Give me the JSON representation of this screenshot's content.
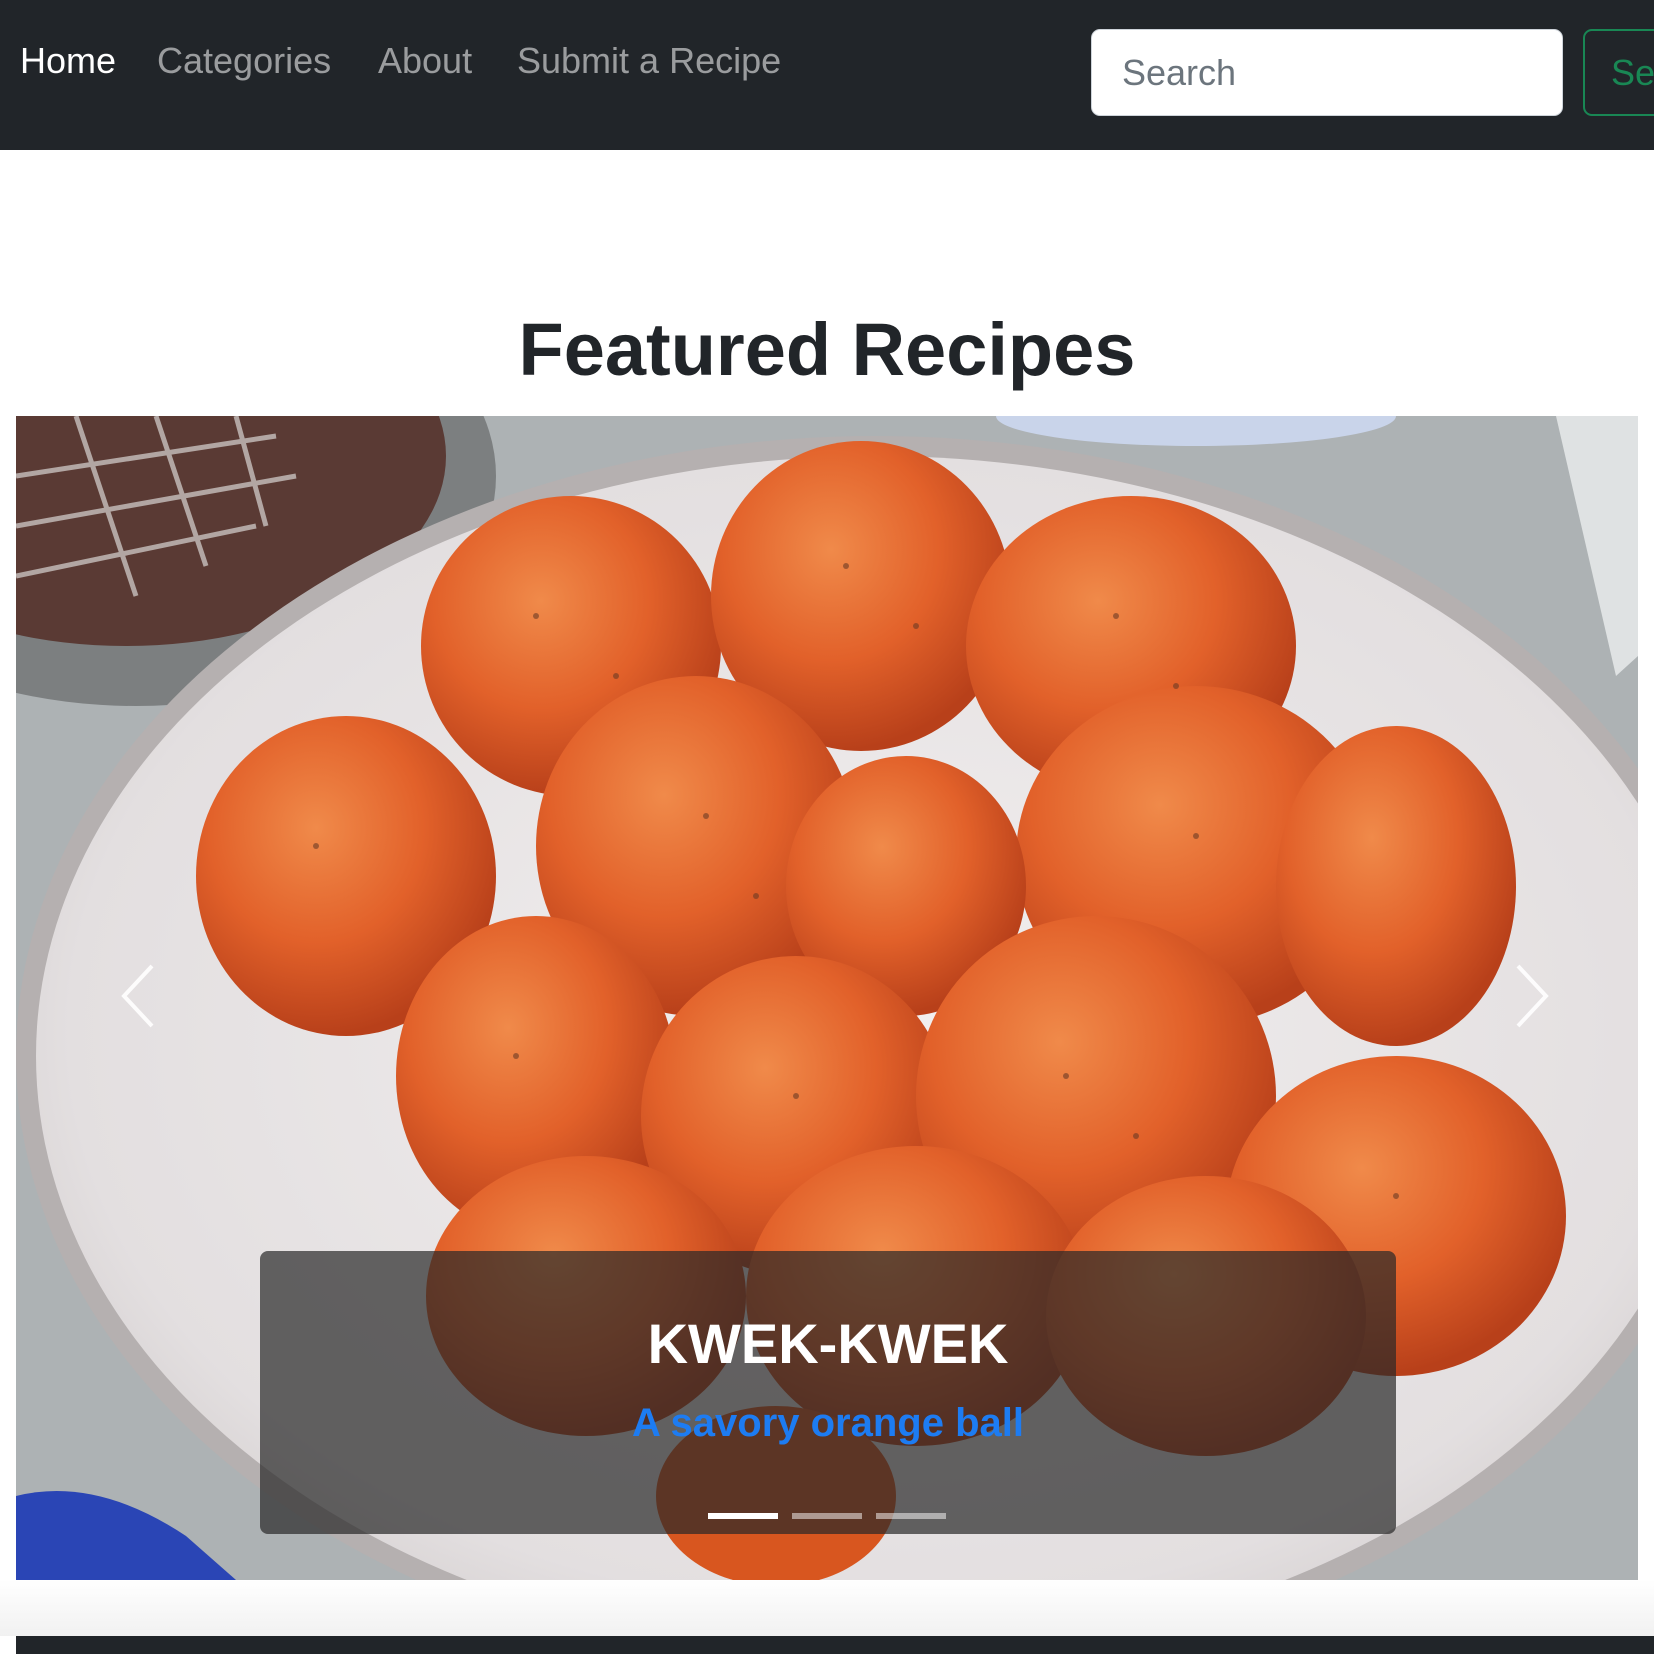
{
  "nav": {
    "items": [
      {
        "label": "Home",
        "active": true
      },
      {
        "label": "Categories",
        "active": false
      },
      {
        "label": "About",
        "active": false
      },
      {
        "label": "Submit a Recipe",
        "active": false
      }
    ],
    "search_placeholder": "Search",
    "search_button_label": "Search"
  },
  "page_title": "Featured Recipes",
  "carousel": {
    "active_index": 0,
    "slides_count": 3,
    "caption_title": "KWEK-KWEK",
    "caption_text": "A savory orange ball",
    "prev_icon": "chevron-left-icon",
    "next_icon": "chevron-right-icon"
  },
  "colors": {
    "navbar_bg": "#212529",
    "search_button": "#198754",
    "caption_text": "#1d7cf2"
  }
}
